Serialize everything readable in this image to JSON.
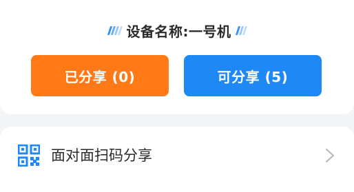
{
  "device": {
    "title": "设备名称:一号机"
  },
  "buttons": {
    "shared_label": "已分享 (0)",
    "available_label": "可分享 (5)"
  },
  "scan_share": {
    "label": "面对面扫码分享"
  },
  "colors": {
    "shared": "#ff7a16",
    "available": "#1e88f5",
    "accent": "#3a8ef6"
  },
  "icons": {
    "qr": "qr-code-icon",
    "chevron": "chevron-right-icon"
  }
}
